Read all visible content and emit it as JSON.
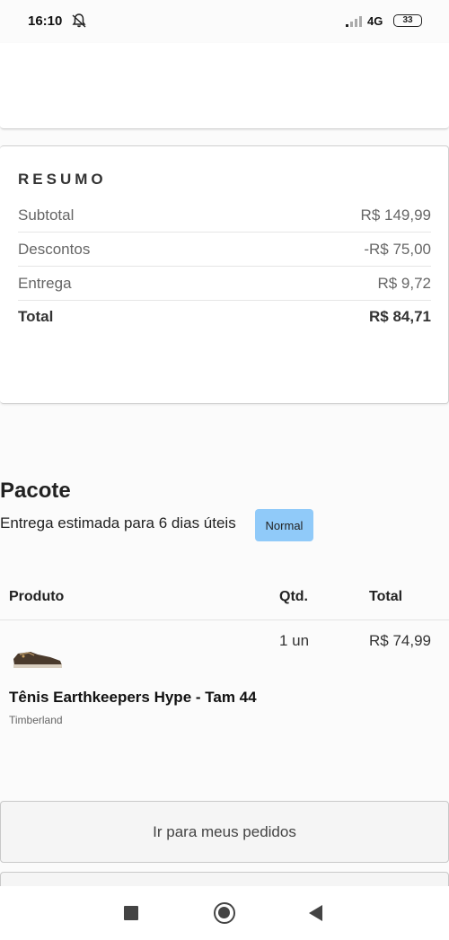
{
  "status": {
    "time": "16:10",
    "network": "4G",
    "battery": "33"
  },
  "summary": {
    "title": "RESUMO",
    "rows": [
      {
        "label": "Subtotal",
        "value": "R$ 149,99"
      },
      {
        "label": "Descontos",
        "value": "-R$ 75,00"
      },
      {
        "label": "Entrega",
        "value": "R$ 9,72"
      },
      {
        "label": "Total",
        "value": "R$ 84,71"
      }
    ]
  },
  "package": {
    "title": "Pacote",
    "delivery": "Entrega estimada para 6 dias úteis",
    "badge": "Normal",
    "headers": {
      "product": "Produto",
      "qty": "Qtd.",
      "total": "Total"
    },
    "item": {
      "name": "Tênis Earthkeepers Hype - Tam 44",
      "brand": "Timberland",
      "qty": "1 un",
      "price": "R$ 74,99"
    }
  },
  "actions": {
    "orders_button": "Ir para meus pedidos"
  },
  "icons": {
    "bell_off": "bell-off-icon",
    "signal": "signal-icon",
    "battery": "battery-icon",
    "nav_recent": "recent-apps-icon",
    "nav_home": "home-icon",
    "nav_back": "back-icon"
  }
}
